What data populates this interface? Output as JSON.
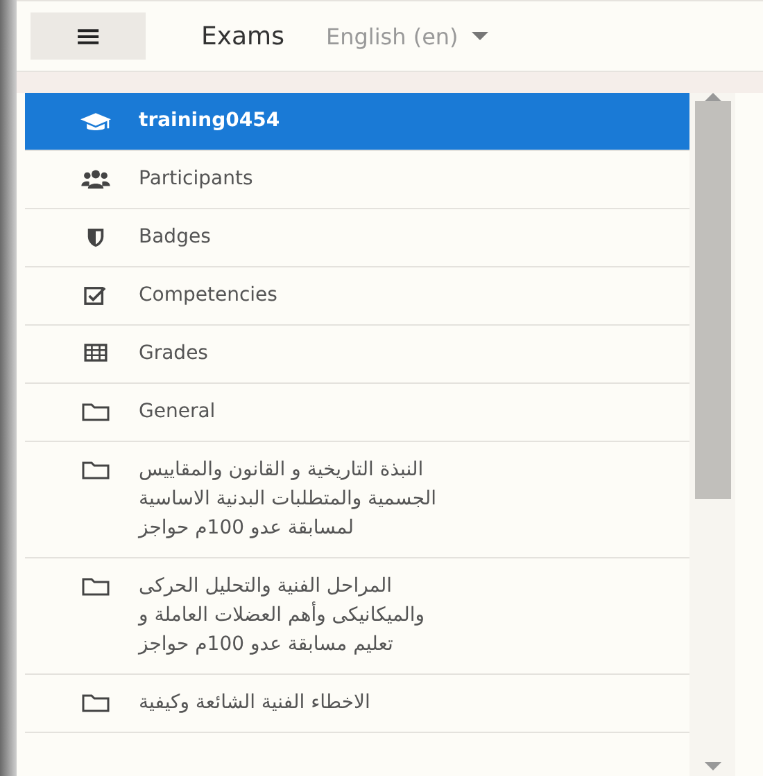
{
  "header": {
    "menu_button": "≡",
    "title": "Exams",
    "language": "English (en)"
  },
  "nav": [
    {
      "kind": "course",
      "label": "training0454",
      "selected": true
    },
    {
      "kind": "participants",
      "label": "Participants",
      "selected": false
    },
    {
      "kind": "badges",
      "label": "Badges",
      "selected": false
    },
    {
      "kind": "competencies",
      "label": "Competencies",
      "selected": false
    },
    {
      "kind": "grades",
      "label": "Grades",
      "selected": false
    },
    {
      "kind": "section",
      "label": "General",
      "selected": false
    },
    {
      "kind": "section",
      "label": "النبذة التاريخية و القانون والمقاييس الجسمية والمتطلبات البدنية الاساسية لمسابقة عدو 100م حواجز",
      "selected": false
    },
    {
      "kind": "section",
      "label": "المراحل الفنية والتحليل الحركى والميكانيكى وأهم العضلات العاملة و تعليم مسابقة عدو 100م حواجز",
      "selected": false
    },
    {
      "kind": "section",
      "label": "الاخطاء الفنية الشائعة وكيفية",
      "selected": false
    }
  ]
}
